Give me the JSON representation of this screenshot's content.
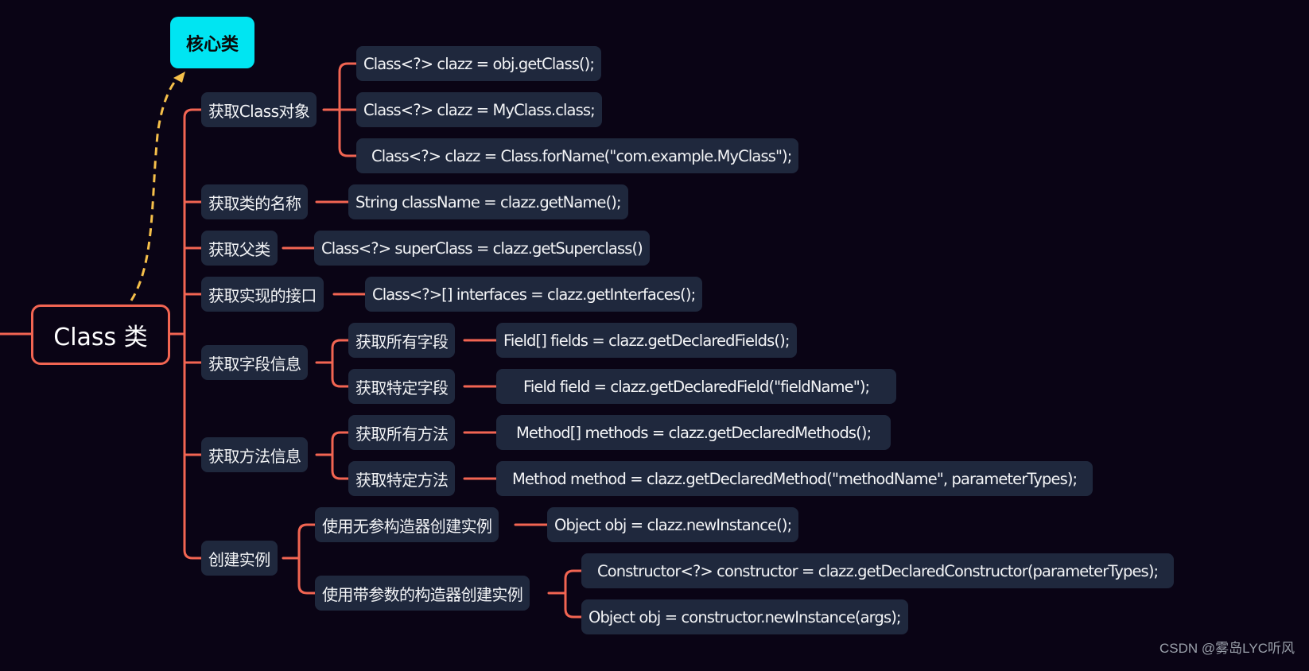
{
  "colors": {
    "background": "#0a0415",
    "branch": "#f26552",
    "node": "#1f283d",
    "tag": "#00e5f2",
    "relation": "#f6c04a"
  },
  "root": {
    "label": "Class 类"
  },
  "tag": {
    "label": "核心类"
  },
  "branches": [
    {
      "label": "获取Class对象",
      "children": [
        {
          "code": "Class<?> clazz = obj.getClass();"
        },
        {
          "code": "Class<?> clazz = MyClass.class;"
        },
        {
          "code": "Class<?> clazz = Class.forName(\"com.example.MyClass\");"
        }
      ]
    },
    {
      "label": "获取类的名称",
      "children": [
        {
          "code": "String className = clazz.getName();"
        }
      ]
    },
    {
      "label": "获取父类",
      "children": [
        {
          "code": "Class<?> superClass = clazz.getSuperclass()"
        }
      ]
    },
    {
      "label": "获取实现的接口",
      "children": [
        {
          "code": "Class<?>[] interfaces = clazz.getInterfaces();"
        }
      ]
    },
    {
      "label": "获取字段信息",
      "children": [
        {
          "label": "获取所有字段",
          "code": "Field[] fields = clazz.getDeclaredFields();"
        },
        {
          "label": "获取特定字段",
          "code": "Field field = clazz.getDeclaredField(\"fieldName\");"
        }
      ]
    },
    {
      "label": "获取方法信息",
      "children": [
        {
          "label": "获取所有方法",
          "code": "Method[] methods = clazz.getDeclaredMethods();"
        },
        {
          "label": "获取特定方法",
          "code": "Method method = clazz.getDeclaredMethod(\"methodName\", parameterTypes);"
        }
      ]
    },
    {
      "label": "创建实例",
      "children": [
        {
          "label": "使用无参构造器创建实例",
          "code": "Object obj = clazz.newInstance();"
        },
        {
          "label": "使用带参数的构造器创建实例",
          "codes": [
            "Constructor<?> constructor = clazz.getDeclaredConstructor(parameterTypes);",
            "Object obj = constructor.newInstance(args);"
          ]
        }
      ]
    }
  ],
  "watermark": "CSDN @雾岛LYC听风"
}
